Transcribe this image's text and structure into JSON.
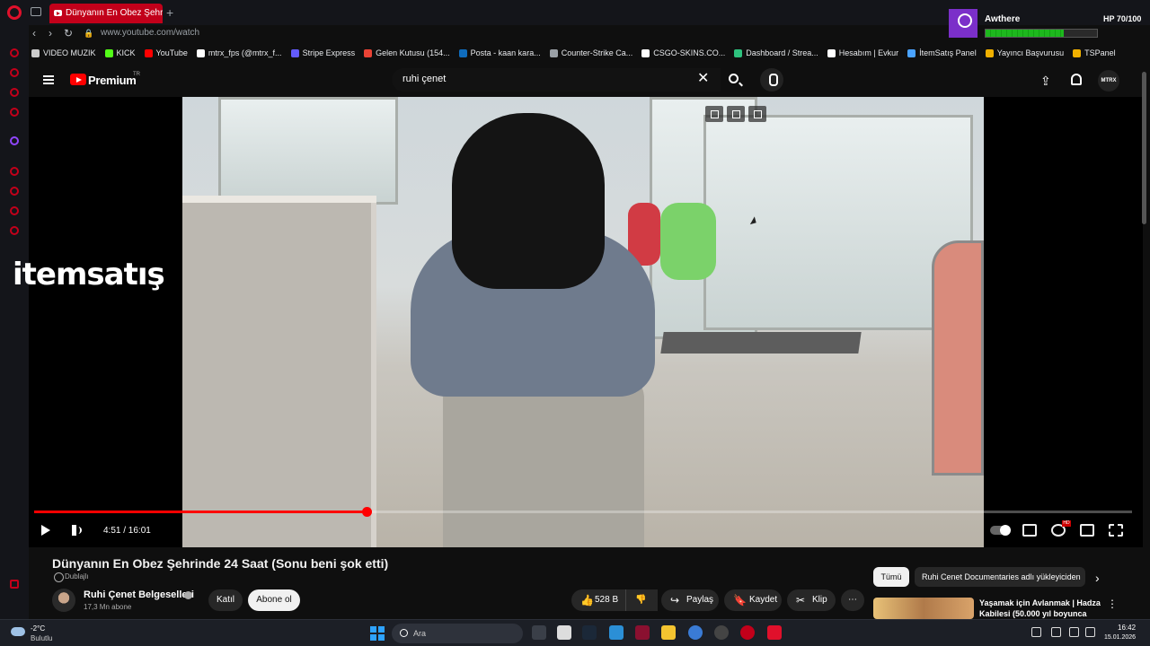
{
  "browser": {
    "tab_title": "Dünyanın En Obez Şehrinde",
    "new_tab": "+",
    "url": "www.youtube.com/watch",
    "bookmarks": [
      {
        "label": "VIDEO MUZIK",
        "color": "#cccccc"
      },
      {
        "label": "KICK",
        "color": "#53fc18"
      },
      {
        "label": "YouTube",
        "color": "#ff0000"
      },
      {
        "label": "mtrx_fps (@mtrx_f...",
        "color": "#ffffff"
      },
      {
        "label": "Stripe Express",
        "color": "#635bff"
      },
      {
        "label": "Gelen Kutusu (154...",
        "color": "#ea4335"
      },
      {
        "label": "Posta - kaan kara...",
        "color": "#0f6cbd"
      },
      {
        "label": "Counter-Strike Ca...",
        "color": "#9aa0a6"
      },
      {
        "label": "CSGO-SKINS.CO...",
        "color": "#ffffff"
      },
      {
        "label": "Dashboard / Strea...",
        "color": "#2ec27e"
      },
      {
        "label": "Hesabım | Evkur",
        "color": "#ffffff"
      },
      {
        "label": "İtemSatış Panel",
        "color": "#4aa3ff"
      },
      {
        "label": "Yayıncı Başvurusu",
        "color": "#f0b000"
      },
      {
        "label": "TSPanel",
        "color": "#f0b000"
      }
    ]
  },
  "overlay": {
    "name": "Awthere",
    "hp": "HP 70/100",
    "hp_fraction": 0.7
  },
  "youtube": {
    "brand": "Premium",
    "region": "TR",
    "search_query": "ruhi çenet",
    "account": "MTRX"
  },
  "player": {
    "current_time": "4:51",
    "duration": "16:01",
    "time_display": "4:51 / 16:01",
    "progress_fraction": 0.303,
    "watermark": "itemsatış",
    "hd_badge": "HD"
  },
  "video": {
    "title": "Dünyanın En Obez Şehrinde 24 Saat (Sonu beni şok etti)",
    "dub_label": "Dublajlı",
    "channel_name": "Ruhi Çenet Belgeselleri",
    "subscribers": "17,3 Mn abone",
    "join_label": "Katıl",
    "subscribe_label": "Abone ol",
    "like_count": "528 B",
    "share_label": "Paylaş",
    "save_label": "Kaydet",
    "clip_label": "Klip",
    "more_label": "⋯"
  },
  "recommendations": {
    "chip_all": "Tümü",
    "chip_uploader": "Ruhi Cenet Documentaries adlı yükleyiciden",
    "first_title": "Yaşamak için Avlanmak | Hadza Kabilesi (50.000 yıl boyunca"
  },
  "taskbar": {
    "weather_temp": "-2°C",
    "weather_desc": "Bulutlu",
    "search_placeholder": "Ara",
    "time": "16:42",
    "date": "15.01.2026"
  }
}
